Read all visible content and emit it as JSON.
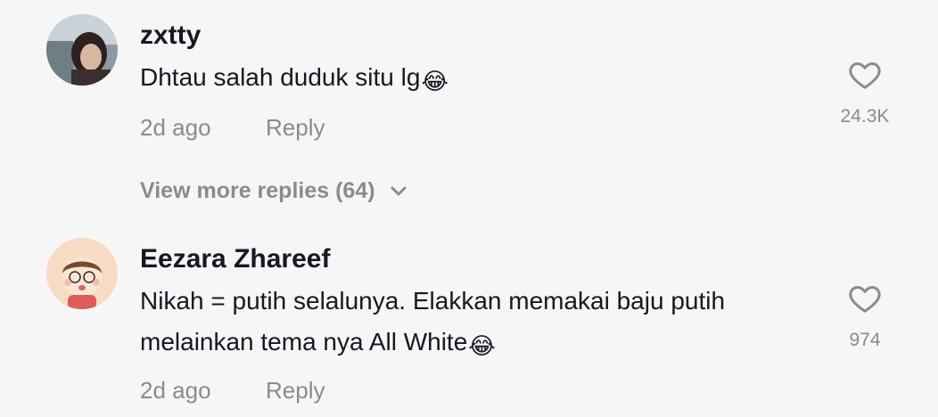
{
  "comments": [
    {
      "username": "zxtty",
      "text": "Dhtau salah duduk situ lg",
      "emoji": "😂",
      "time": "2d ago",
      "reply_label": "Reply",
      "likes": "24.3K",
      "view_more_label": "View more replies (64)",
      "avatar": "photo-avatar"
    },
    {
      "username": "Eezara Zhareef",
      "text_line1": "Nikah = putih selalunya. Elakkan memakai baju putih",
      "text_line2": "melainkan tema nya All White",
      "emoji": "😂",
      "time": "2d ago",
      "reply_label": "Reply",
      "likes": "974",
      "avatar": "cartoon-girl-avatar"
    }
  ],
  "icons": {
    "like": "heart-outline-icon",
    "expand": "chevron-down-icon"
  },
  "colors": {
    "background": "#f6f6f6",
    "primary_text": "#161823",
    "secondary_text": "#8a8b91"
  }
}
